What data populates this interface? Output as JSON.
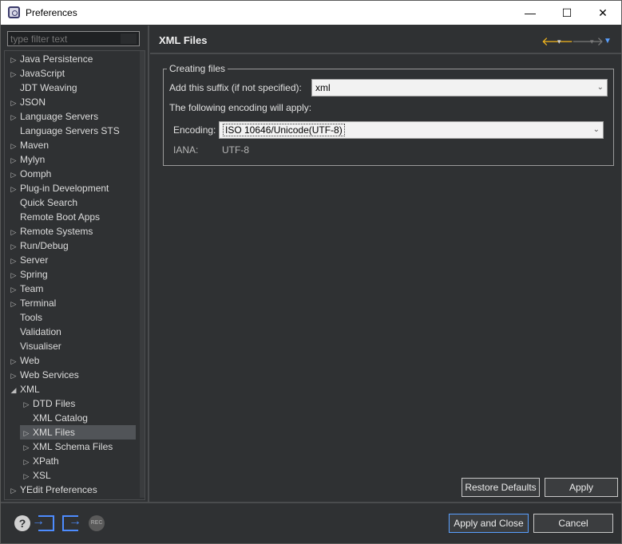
{
  "window": {
    "title": "Preferences",
    "controls": {
      "minimize": "—",
      "maximize": "☐",
      "close": "✕"
    }
  },
  "filter": {
    "placeholder": "type filter text"
  },
  "tree": {
    "items": [
      {
        "label": "Java Persistence",
        "expandable": true
      },
      {
        "label": "JavaScript",
        "expandable": true
      },
      {
        "label": "JDT Weaving",
        "expandable": false
      },
      {
        "label": "JSON",
        "expandable": true
      },
      {
        "label": "Language Servers",
        "expandable": true
      },
      {
        "label": "Language Servers STS",
        "expandable": false
      },
      {
        "label": "Maven",
        "expandable": true
      },
      {
        "label": "Mylyn",
        "expandable": true
      },
      {
        "label": "Oomph",
        "expandable": true
      },
      {
        "label": "Plug-in Development",
        "expandable": true
      },
      {
        "label": "Quick Search",
        "expandable": false
      },
      {
        "label": "Remote Boot Apps",
        "expandable": false
      },
      {
        "label": "Remote Systems",
        "expandable": true
      },
      {
        "label": "Run/Debug",
        "expandable": true
      },
      {
        "label": "Server",
        "expandable": true
      },
      {
        "label": "Spring",
        "expandable": true
      },
      {
        "label": "Team",
        "expandable": true
      },
      {
        "label": "Terminal",
        "expandable": true
      },
      {
        "label": "Tools",
        "expandable": false
      },
      {
        "label": "Validation",
        "expandable": false
      },
      {
        "label": "Visualiser",
        "expandable": false
      },
      {
        "label": "Web",
        "expandable": true
      },
      {
        "label": "Web Services",
        "expandable": true
      },
      {
        "label": "XML",
        "expandable": true,
        "expanded": true
      },
      {
        "label": "DTD Files",
        "expandable": true,
        "child": true
      },
      {
        "label": "XML Catalog",
        "expandable": false,
        "child": true
      },
      {
        "label": "XML Files",
        "expandable": true,
        "child": true,
        "selected": true
      },
      {
        "label": "XML Schema Files",
        "expandable": true,
        "child": true
      },
      {
        "label": "XPath",
        "expandable": true,
        "child": true
      },
      {
        "label": "XSL",
        "expandable": true,
        "child": true
      },
      {
        "label": "YEdit Preferences",
        "expandable": true
      }
    ]
  },
  "page": {
    "title": "XML Files",
    "nav": {
      "back": "🡐",
      "forward": "🡒",
      "dropdown": "▾",
      "menu": "▼"
    },
    "group_label": "Creating files",
    "suffix_label": "Add this suffix (if not specified):",
    "suffix_value": "xml",
    "encoding_note": "The following encoding will apply:",
    "encoding_label": "Encoding:",
    "encoding_value": "ISO 10646/Unicode(UTF-8)",
    "iana_label": "IANA:",
    "iana_value": "UTF-8",
    "combo_arrow": "⌄"
  },
  "buttons": {
    "restore_defaults": "Restore Defaults",
    "apply": "Apply",
    "apply_and_close": "Apply and Close",
    "cancel": "Cancel"
  },
  "footer": {
    "help": "?",
    "record": "REC"
  },
  "colors": {
    "accent": "#5aa0ff",
    "back_arrow": "#f3b61d",
    "background": "#2f3133"
  }
}
